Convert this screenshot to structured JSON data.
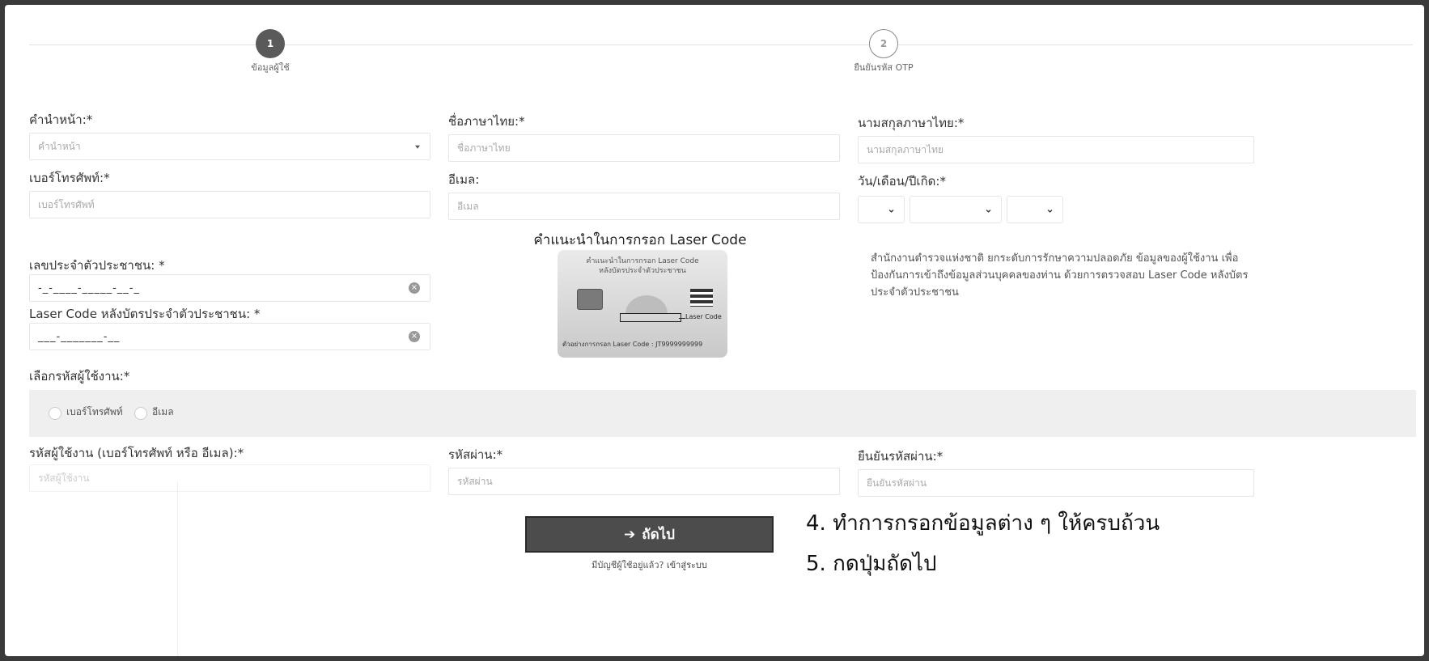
{
  "stepper": {
    "steps": [
      {
        "number": "1",
        "label": "ข้อมูลผู้ใช้",
        "active": true
      },
      {
        "number": "2",
        "label": "ยืนยันรหัส OTP",
        "active": false
      }
    ]
  },
  "form": {
    "title_prefix": {
      "label": "คำนำหน้า:*",
      "placeholder": "คำนำหน้า"
    },
    "first_name": {
      "label": "ชื่อภาษาไทย:*",
      "placeholder": "ชื่อภาษาไทย"
    },
    "last_name": {
      "label": "นามสกุลภาษาไทย:*",
      "placeholder": "นามสกุลภาษาไทย"
    },
    "phone": {
      "label": "เบอร์โทรศัพท์:*",
      "placeholder": "เบอร์โทรศัพท์"
    },
    "email": {
      "label": "อีเมล:",
      "placeholder": "อีเมล"
    },
    "dob": {
      "label": "วัน/เดือน/ปีเกิด:*"
    },
    "citizen_id": {
      "label": "เลขประจำตัวประชาชน: *",
      "value": "-_-____-_____-__-_"
    },
    "laser_code": {
      "label": "Laser Code หลังบัตรประจำตัวประชาชน: *",
      "value": "___-_______-__"
    },
    "username_type": {
      "label": "เลือกรหัสผู้ใช้งาน:*",
      "options": [
        "เบอร์โทรศัพท์",
        "อีเมล"
      ]
    },
    "username": {
      "label": "รหัสผู้ใช้งาน (เบอร์โทรศัพท์ หรือ อีเมล):*",
      "placeholder": "รหัสผู้ใช้งาน"
    },
    "password": {
      "label": "รหัสผ่าน:*",
      "placeholder": "รหัสผ่าน"
    },
    "confirm_password": {
      "label": "ยืนยันรหัสผ่าน:*",
      "placeholder": "ยืนยันรหัสผ่าน"
    }
  },
  "laser_guide": {
    "title": "คำแนะนำในการกรอก Laser Code",
    "card_title": "คำแนะนำในการกรอก Laser Code",
    "card_subtitle": "หลังบัตรประจำตัวประชาชน",
    "card_tag": "Laser Code",
    "card_example": "ตัวอย่างการกรอก Laser Code : JT9999999999"
  },
  "info": {
    "text": "สำนักงานตำรวจแห่งชาติ ยกระดับการรักษาความปลอดภัย ข้อมูลของผู้ใช้งาน เพื่อป้องกันการเข้าถึงข้อมูลส่วนบุคคลของท่าน ด้วยการตรวจสอบ Laser Code หลังบัตรประจำตัวประชาชน"
  },
  "actions": {
    "next_label": "ถัดไป",
    "login_hint": "มีบัญชีผู้ใช้อยู่แล้ว?",
    "login_link": "เข้าสู่ระบบ"
  },
  "instructions": {
    "step4": "4. ทำการกรอกข้อมูลต่าง ๆ ให้ครบถ้วน",
    "step5": "5. กดปุ่มถัดไป"
  },
  "icons": {
    "next_arrow": "arrow-right-icon",
    "dropdown": "chevron-down-icon",
    "clear": "clear-icon"
  }
}
